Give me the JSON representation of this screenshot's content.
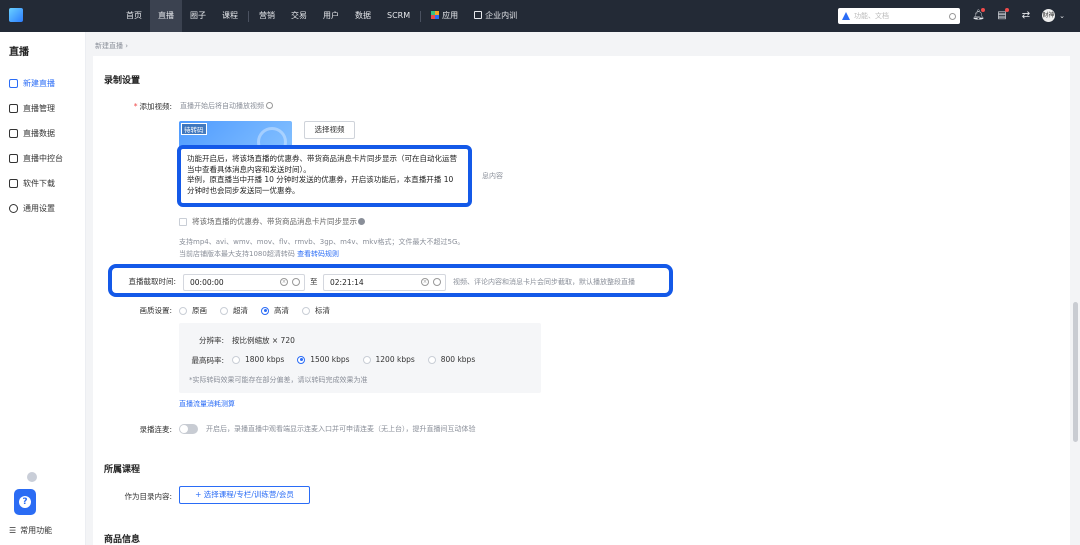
{
  "topbar": {
    "nav": [
      "首页",
      "直播",
      "圈子",
      "课程",
      "营销",
      "交易",
      "用户",
      "数据",
      "SCRM",
      "应用",
      "企业内训"
    ],
    "active_nav": "直播",
    "search_placeholder": "功能、文档",
    "avatar_text": "财神"
  },
  "sidebar": {
    "title": "直播",
    "items": [
      "新建直播",
      "直播管理",
      "直播数据",
      "直播中控台",
      "软件下载",
      "通用设置"
    ],
    "active_item": "新建直播",
    "bottom_label": "常用功能"
  },
  "breadcrumb": "新建直播 ›",
  "record": {
    "section_title": "录制设置",
    "add_video_label": "添加视频:",
    "add_video_hint": "直播开始后将自动播放视频",
    "thumb_tag": "待转码",
    "select_video_button": "选择视频",
    "callout_line1": "功能开启后，将该场直播的优惠券、带货商品消息卡片同步显示（可在自动化运营当中查看具体消息内容和发送时间）。",
    "callout_line2": "举例，原直播当中开播 10 分钟时发送的优惠券，开启该功能后，本直播开播 10 分钟时也会同步发送同一优惠券。",
    "callout_overflow": "息内容",
    "sync_checkbox_label": "将该场直播的优惠券、带货商品消息卡片同步显示",
    "format_hint": "支持mp4、avi、wmv、mov、flv、rmvb、3gp、m4v、mkv格式；文件最大不超过5G。",
    "store_hint_prefix": "当前店铺版本最大支持1080超清转码",
    "store_hint_link": "查看转码规则",
    "clip_label": "直播截取时间:",
    "clip_start": "00:00:00",
    "clip_to": "至",
    "clip_end": "02:21:14",
    "clip_hint": "视频、评论内容和消息卡片会同步截取，默认播放整段直播",
    "quality_label": "画质设置:",
    "quality_options": [
      "原画",
      "超清",
      "高清",
      "标清"
    ],
    "quality_selected": "高清",
    "resolution_label": "分辨率:",
    "resolution_value": "按比例缩放 × 720",
    "bitrate_label": "最高码率:",
    "bitrate_options": [
      "1800 kbps",
      "1500 kbps",
      "1200 kbps",
      "800 kbps"
    ],
    "bitrate_selected": "1500 kbps",
    "panel_note": "*实际转码效果可能存在部分偏差，请以转码完成效果为准",
    "traffic_link": "直播流量消耗测算",
    "linkmic_label": "录播连麦:",
    "linkmic_hint": "开启后，录播直播中观看端显示连麦入口并可申请连麦（无上台），提升直播间互动体验"
  },
  "course": {
    "section_title": "所属课程",
    "catalog_label": "作为目录内容:",
    "add_button": "+ 选择课程/专栏/训练营/会员"
  },
  "goods": {
    "section_title": "商品信息"
  },
  "colors": {
    "accent": "#2a6cf6",
    "highlight": "#1459e8",
    "topbar": "#232a36"
  }
}
